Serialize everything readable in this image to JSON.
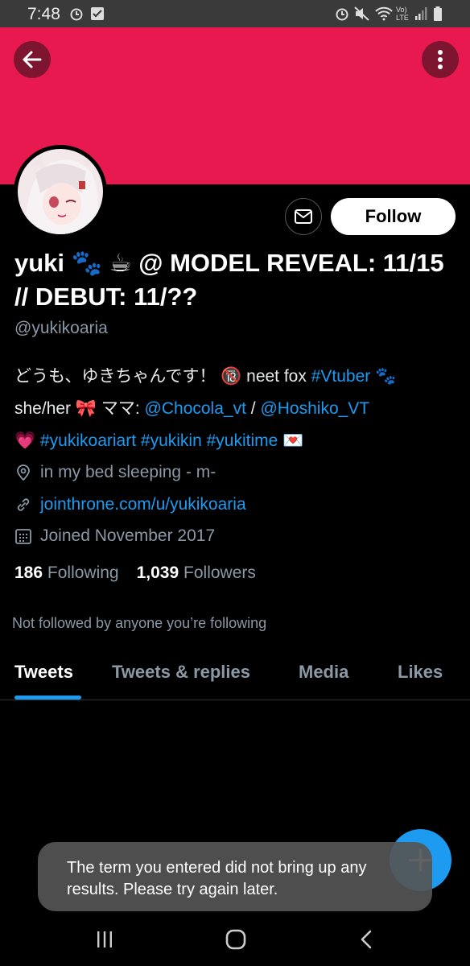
{
  "status_bar": {
    "time": "7:48",
    "network": "Vo) LTE"
  },
  "colors": {
    "banner": "#e8194e",
    "accent": "#1d9bf0"
  },
  "header": {
    "back_icon": "arrow-left-icon",
    "more_icon": "more-vertical-icon"
  },
  "profile": {
    "name": "yuki 🐾 ☕ @ MODEL REVEAL: 11/15 // DEBUT: 11/??",
    "handle": "@yukikoaria",
    "follow_label": "Follow",
    "message_icon": "mail-icon",
    "bio": {
      "line1_text": "どうも、ゆきちゃんです！ 🔞 neet fox ",
      "line1_link": "#Vtuber",
      "line1_emoji": " 🐾",
      "line2_text": "she/her 🎀 ママ: ",
      "line2_link1": "@Chocola_vt",
      "line2_sep": " / ",
      "line2_link2": "@Hoshiko_VT",
      "line3_emoji": "💗 ",
      "line3_link1": "#yukikoariart",
      "line3_link2": "#yukikin",
      "line3_link3": "#yukitime",
      "line3_emoji2": " 💌"
    },
    "location": "in my bed sleeping - m-",
    "website": "jointhrone.com/u/yukikoaria",
    "joined": "Joined November 2017",
    "following_count": "186",
    "following_label": "Following",
    "followers_count": "1,039",
    "followers_label": "Followers",
    "not_followed": "Not followed by anyone you’re following"
  },
  "tabs": [
    {
      "label": "Tweets"
    },
    {
      "label": "Tweets & replies"
    },
    {
      "label": "Media"
    },
    {
      "label": "Likes"
    }
  ],
  "toast": {
    "message": "The term you entered did not bring up any results. Please try again later."
  },
  "fab": {
    "icon": "plus-icon"
  },
  "nav": {
    "recents_icon": "recents-icon",
    "home_icon": "home-icon",
    "back_icon": "back-chevron-icon"
  }
}
